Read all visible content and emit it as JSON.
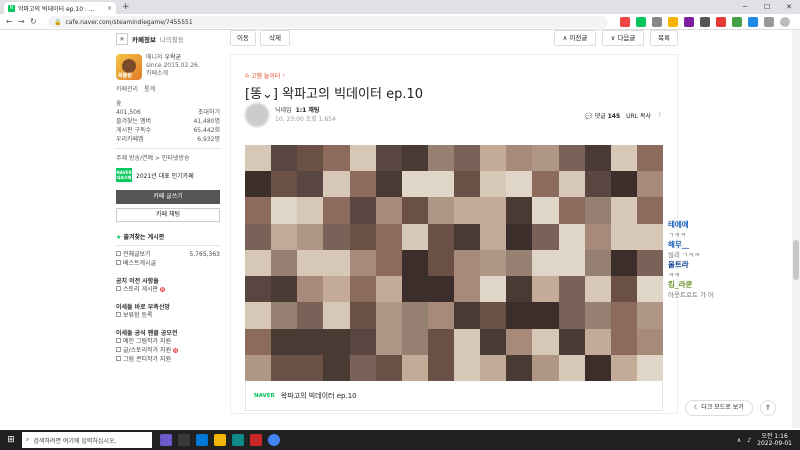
{
  "browser": {
    "tab_title": "악파고의 빅데이터 ep.10 : ...",
    "tab_close": "×",
    "new_tab": "+",
    "url": "cafe.naver.com/steamindiegame/7455551",
    "win_min": "─",
    "win_max": "☐",
    "win_close": "✕",
    "back": "←",
    "forward": "→",
    "reload": "↻"
  },
  "sidebar": {
    "tab_cafeinfo": "카페정보",
    "tab_myactivity": "나의활동",
    "avatar_text": "왁물원",
    "manager_label": "매니저",
    "manager_name": "우왁굳",
    "since": "since 2015.02.26.",
    "cafe_intro": "카페소개",
    "cafe_manage": "카페관리",
    "stats_link": "통계",
    "level_label": "숲",
    "members": "401,506",
    "invite": "초대하기",
    "stat_rows": [
      {
        "label": "즐겨찾는 멤버",
        "value": "41,480명"
      },
      {
        "label": "게시판 구독수",
        "value": "65,442회"
      },
      {
        "label": "우리카페앱",
        "value": "6,932명"
      }
    ],
    "theme": "주제 방송/연예 > 인터넷방송",
    "naver_badge": "NAVER 대표카페",
    "popular_badge": "2021년 대표 인기카페",
    "write_button": "카페 글쓰기",
    "chat_button": "카페 채팅",
    "fav_header": "즐겨찾는 게시판",
    "all_posts": "전체글보기",
    "all_posts_count": "5,765,363",
    "best_posts": "베스트게시글",
    "section1": "공지 이전 사항들",
    "section1_item": "스토리 게시판",
    "section2": "이세돌 바로 부족신앙",
    "section2_item": "보류함 등록",
    "section3": "이세돌 공식 팬클 공모전",
    "section3_items": [
      "예인 그림작가 지원",
      "글/스토리작가 지원",
      "그림 콘티작가 지원"
    ]
  },
  "toolbar": {
    "move": "이동",
    "delete": "삭제",
    "prev": "이전글",
    "next": "다음글",
    "list": "목록"
  },
  "post": {
    "board": "고멤 놀이터",
    "title": "[똥⌄] 왁파고의 빅데이터 ep.10",
    "author_name": "닉네임",
    "author_rank": "1:1 채팅",
    "date": "10. 23:00  조회 1,654",
    "comment_label": "댓글",
    "comment_count": "145",
    "url_copy": "URL 복사",
    "more": "⋮",
    "caption_naver": "NAVER",
    "caption_title": "왁파고의 빅데이터 ep.10"
  },
  "chat": [
    {
      "name": "테에에",
      "msg": "ㄱㅋㅋ"
    },
    {
      "name": "해무__",
      "msg": "빌리 ㄱㅋㅋ"
    },
    {
      "name": "울트라",
      "msg": "ㅋㅋ"
    },
    {
      "name": "킹_라쿤",
      "msg": "아웃트로트 가 어"
    }
  ],
  "darkmode": "다크 모드로 보기",
  "totop": "↑",
  "taskbar": {
    "search_placeholder": "검색하려면 여기에 입력하십시오.",
    "time": "오전 1:16",
    "date": "2022-09-01"
  },
  "colors": {
    "naver_green": "#03c75a",
    "board_red": "#e44a2c"
  }
}
